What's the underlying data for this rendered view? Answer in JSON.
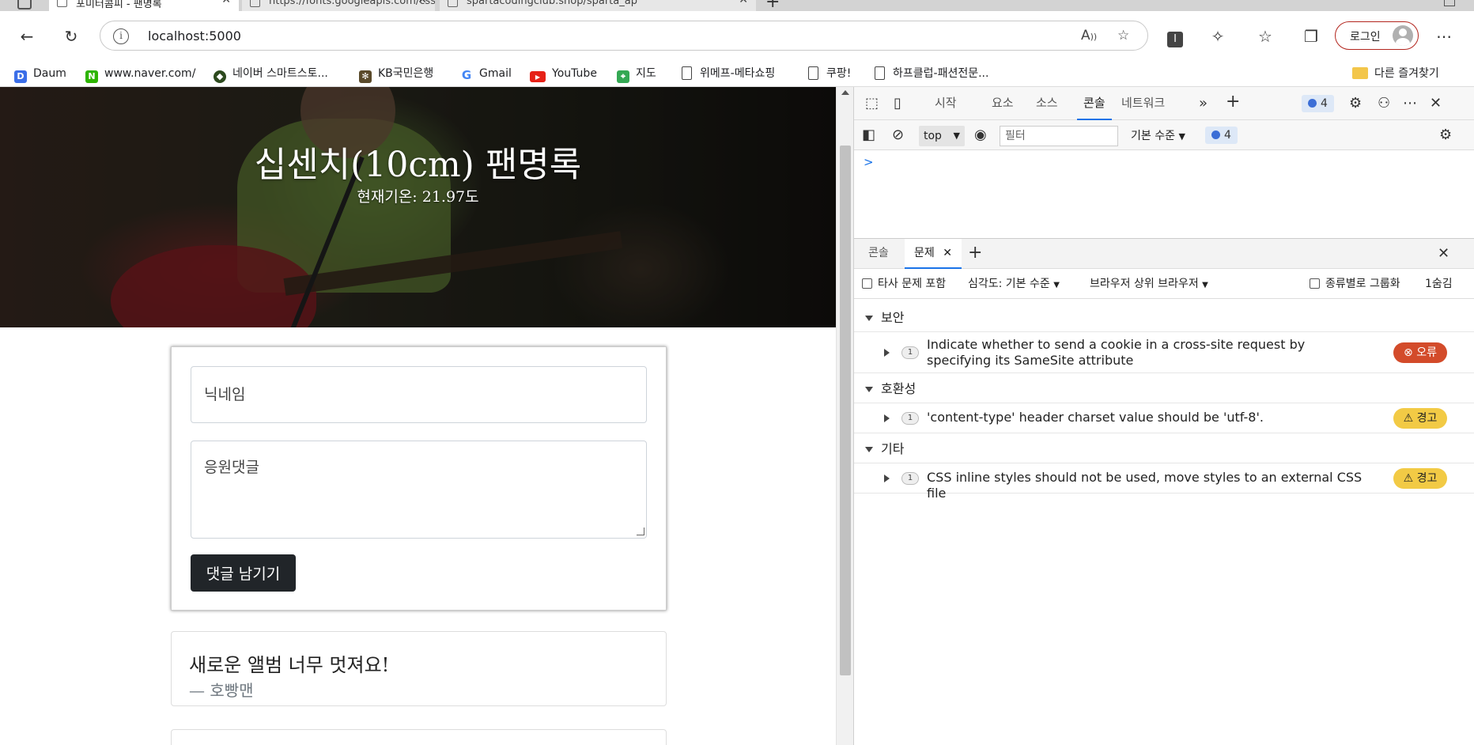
{
  "browser": {
    "tabs": [
      {
        "title": "포미터콤피 - 팬명록",
        "active": true
      },
      {
        "title": "https://fonts.googleapis.com/css",
        "active": false
      },
      {
        "title": "spartacodingclub.shop/sparta_ap",
        "active": false
      }
    ],
    "url": "localhost:5000",
    "login_label": "로그인",
    "bookmarks": [
      {
        "label": "Daum",
        "icon": "daum-icon",
        "color": "#3b6ee8"
      },
      {
        "label": "www.naver.com/",
        "icon": "naver-icon",
        "color": "#2db400"
      },
      {
        "label": "네이버 스마트스토...",
        "icon": "smartstore-icon",
        "color": "#2d4a1e"
      },
      {
        "label": "KB국민은행",
        "icon": "kb-icon",
        "color": "#5a4a2a"
      },
      {
        "label": "Gmail",
        "icon": "google-icon",
        "color": "#ffffff"
      },
      {
        "label": "YouTube",
        "icon": "youtube-icon",
        "color": "#e62117"
      },
      {
        "label": "지도",
        "icon": "maps-icon",
        "color": "#34a853"
      },
      {
        "label": "위메프-메타쇼핑",
        "icon": "doc-icon",
        "color": ""
      },
      {
        "label": "쿠팡!",
        "icon": "doc-icon",
        "color": ""
      },
      {
        "label": "하프클럽-패션전문...",
        "icon": "doc-icon",
        "color": ""
      }
    ],
    "other_bookmarks": "다른 즐겨찾기"
  },
  "page": {
    "title": "십센치(10cm) 팬명록",
    "temperature": "현재기온: 21.97도",
    "nickname_placeholder": "닉네임",
    "comment_placeholder": "응원댓글",
    "submit_label": "댓글 남기기",
    "comments": [
      {
        "text": "새로운 앨범 너무 멋져요!",
        "author": "— 호빵맨"
      }
    ]
  },
  "devtools": {
    "tabs": [
      "시작",
      "요소",
      "소스",
      "콘솔",
      "네트워크"
    ],
    "active_tab": "콘솔",
    "issue_count": "4",
    "context": "top",
    "filter_placeholder": "필터",
    "level": "기본 수준",
    "prompt": ">",
    "drawer_tabs": [
      "콘솔",
      "문제"
    ],
    "drawer_active": "문제",
    "issues_bar": {
      "third_party": "타사 문제 포함",
      "severity": "심각도: 기본 수준",
      "browser": "브라우저 상위 브라우저",
      "group_by_kind": "종류별로 그룹화",
      "hidden": "1숨김"
    },
    "groups": [
      {
        "name": "보안",
        "items": [
          {
            "count": "1",
            "message": "Indicate whether to send a cookie in a cross-site request by specifying its SameSite attribute",
            "level": "오류"
          }
        ]
      },
      {
        "name": "호환성",
        "items": [
          {
            "count": "1",
            "message": "'content-type' header charset value should be 'utf-8'.",
            "level": "경고"
          }
        ]
      },
      {
        "name": "기타",
        "items": [
          {
            "count": "1",
            "message": "CSS inline styles should not be used, move styles to an external CSS file",
            "level": "경고"
          }
        ]
      }
    ]
  }
}
